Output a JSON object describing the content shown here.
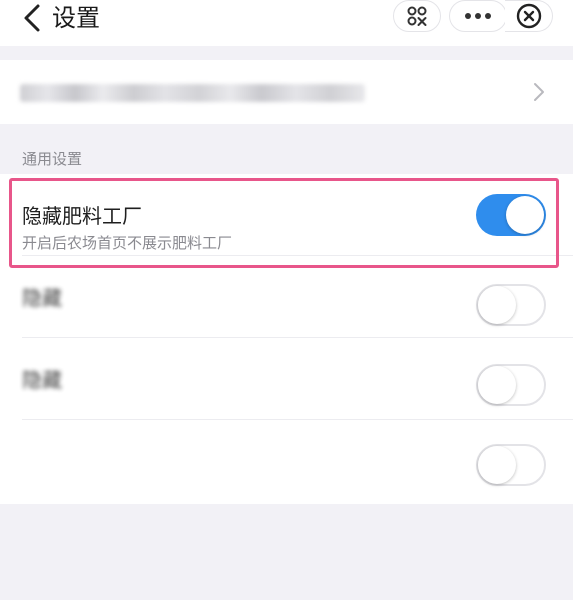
{
  "header": {
    "title": "设置"
  },
  "icons": {
    "back": "chevron-left-icon",
    "scan": "scan-icon",
    "more": "more-icon",
    "close": "close-icon",
    "row_arrow": "chevron-right-icon"
  },
  "section": {
    "label": "通用设置"
  },
  "settings": [
    {
      "name": "隐藏肥料工厂",
      "desc": "开启后农场首页不展示肥料工厂",
      "enabled": true
    },
    {
      "name": "隐藏",
      "desc": "",
      "enabled": false
    },
    {
      "name": "隐藏",
      "desc": "",
      "enabled": false
    },
    {
      "name": "",
      "desc": "",
      "enabled": false
    }
  ],
  "colors": {
    "toggle_on": "#2f8ded",
    "highlight_border": "#e8568a"
  }
}
